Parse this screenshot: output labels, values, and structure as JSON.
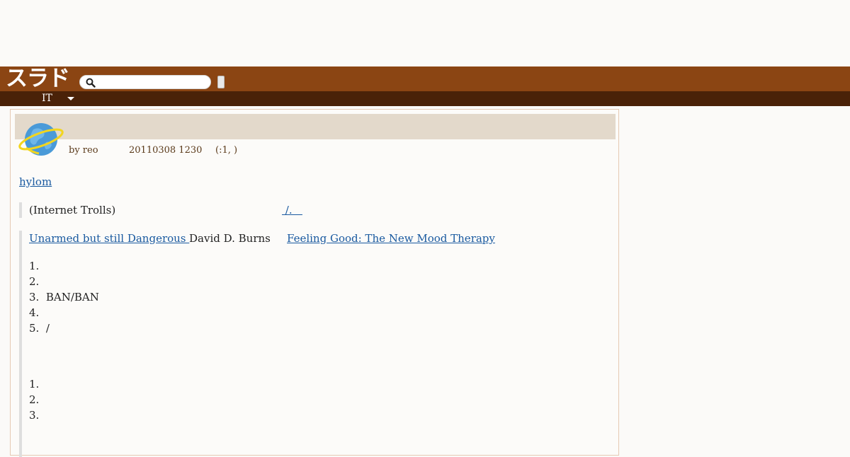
{
  "header": {
    "logo_text": "スラド",
    "search_icon": "search-icon",
    "search_placeholder": "",
    "search_button_label": ""
  },
  "nav": {
    "section_label": "IT",
    "dropdown_icon": "caret-down-icon"
  },
  "article": {
    "title": "",
    "topic_icon": "globe-planet-icon",
    "author": "by reo",
    "date": "20110308 1230",
    "comment_count": "(:1, )",
    "tag_link": "hylom",
    "quote1": {
      "text": "(Internet Trolls)",
      "link": " /.   "
    },
    "quote2": {
      "link1": "Unarmed but still Dangerous ",
      "author": "David D. Burns",
      "link2": "Feeling Good: The New Mood Therapy",
      "list1": [
        "1.",
        "2.",
        "3.  BAN/BAN",
        "4.",
        "5.  /"
      ],
      "list2": [
        "1.",
        "2.",
        "3."
      ]
    }
  },
  "colors": {
    "header_bg": "#8b4513",
    "subnav_bg": "#4a2208",
    "title_bar_bg": "#e3d9cb",
    "link": "#1a5aa0"
  }
}
